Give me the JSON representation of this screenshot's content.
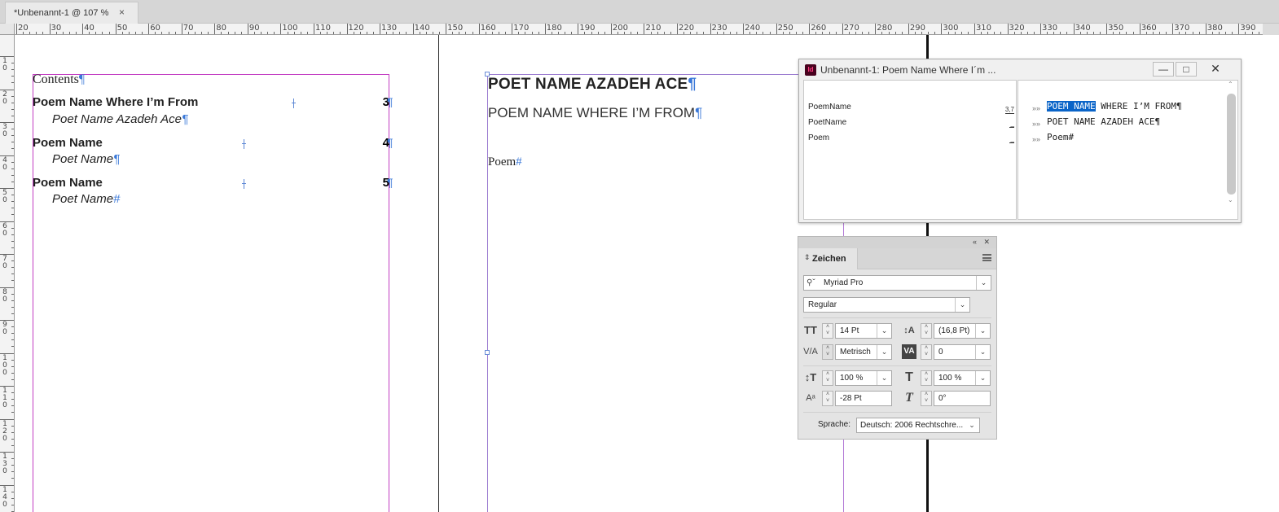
{
  "tab": {
    "title": "*Unbenannt-1 @ 107 %",
    "close": "×"
  },
  "ruler": {
    "h_labels": [
      "20",
      "30",
      "40",
      "50",
      "60",
      "70",
      "80",
      "90",
      "100",
      "110",
      "120",
      "130",
      "140",
      "150",
      "160",
      "170",
      "180",
      "190",
      "200",
      "210",
      "220",
      "230",
      "240",
      "250",
      "260",
      "270",
      "280",
      "290",
      "300",
      "310",
      "320",
      "330",
      "340",
      "350",
      "360",
      "370",
      "380",
      "390"
    ],
    "v_labels": [
      "10",
      "20",
      "30",
      "40",
      "50",
      "60",
      "70",
      "80",
      "90",
      "100",
      "110",
      "120",
      "130",
      "140"
    ]
  },
  "left_page": {
    "heading": "Contents",
    "entries": [
      {
        "title": "Poem Name Where I’m From",
        "poet": "Poet Name Azadeh Ace",
        "page": "3"
      },
      {
        "title": "Poem Name",
        "poet": "Poet Name",
        "page": "4"
      },
      {
        "title": "Poem Name",
        "poet": "Poet Name",
        "page": "5"
      }
    ]
  },
  "right_page": {
    "poet_heading": "POET NAME AZADEH ACE",
    "poem_heading": "POEM NAME WHERE I’M FROM",
    "body": "Poem"
  },
  "marks": {
    "pilcrow": "¶",
    "end": "#"
  },
  "story_editor": {
    "title": "Unbenannt-1: Poem Name Where I´m ...",
    "app_icon": "Id",
    "buttons": {
      "minimize": "—",
      "maximize": "□",
      "close": "✕"
    },
    "styles": [
      {
        "name": "PoemName",
        "depth": "3,7"
      },
      {
        "name": "PoetName",
        "depth": "_"
      },
      {
        "name": "Poem",
        "depth": "_"
      }
    ],
    "lines": [
      {
        "selected": "POEM NAME",
        "rest": " WHERE I’M FROM¶"
      },
      {
        "selected": "",
        "rest": "POET NAME AZADEH ACE¶"
      },
      {
        "selected": "",
        "rest": "Poem#"
      }
    ],
    "line_marker": "»»"
  },
  "character_panel": {
    "tab_label": "Zeichen",
    "font_family": "Myriad Pro",
    "font_style": "Regular",
    "font_size": "14 Pt",
    "leading": "(16,8 Pt)",
    "kerning": "Metrisch",
    "tracking": "0",
    "vertical_scale": "100 %",
    "horizontal_scale": "100 %",
    "baseline_shift": "-28 Pt",
    "skew": "0°",
    "language_label": "Sprache:",
    "language": "Deutsch: 2006 Rechtschre..."
  }
}
